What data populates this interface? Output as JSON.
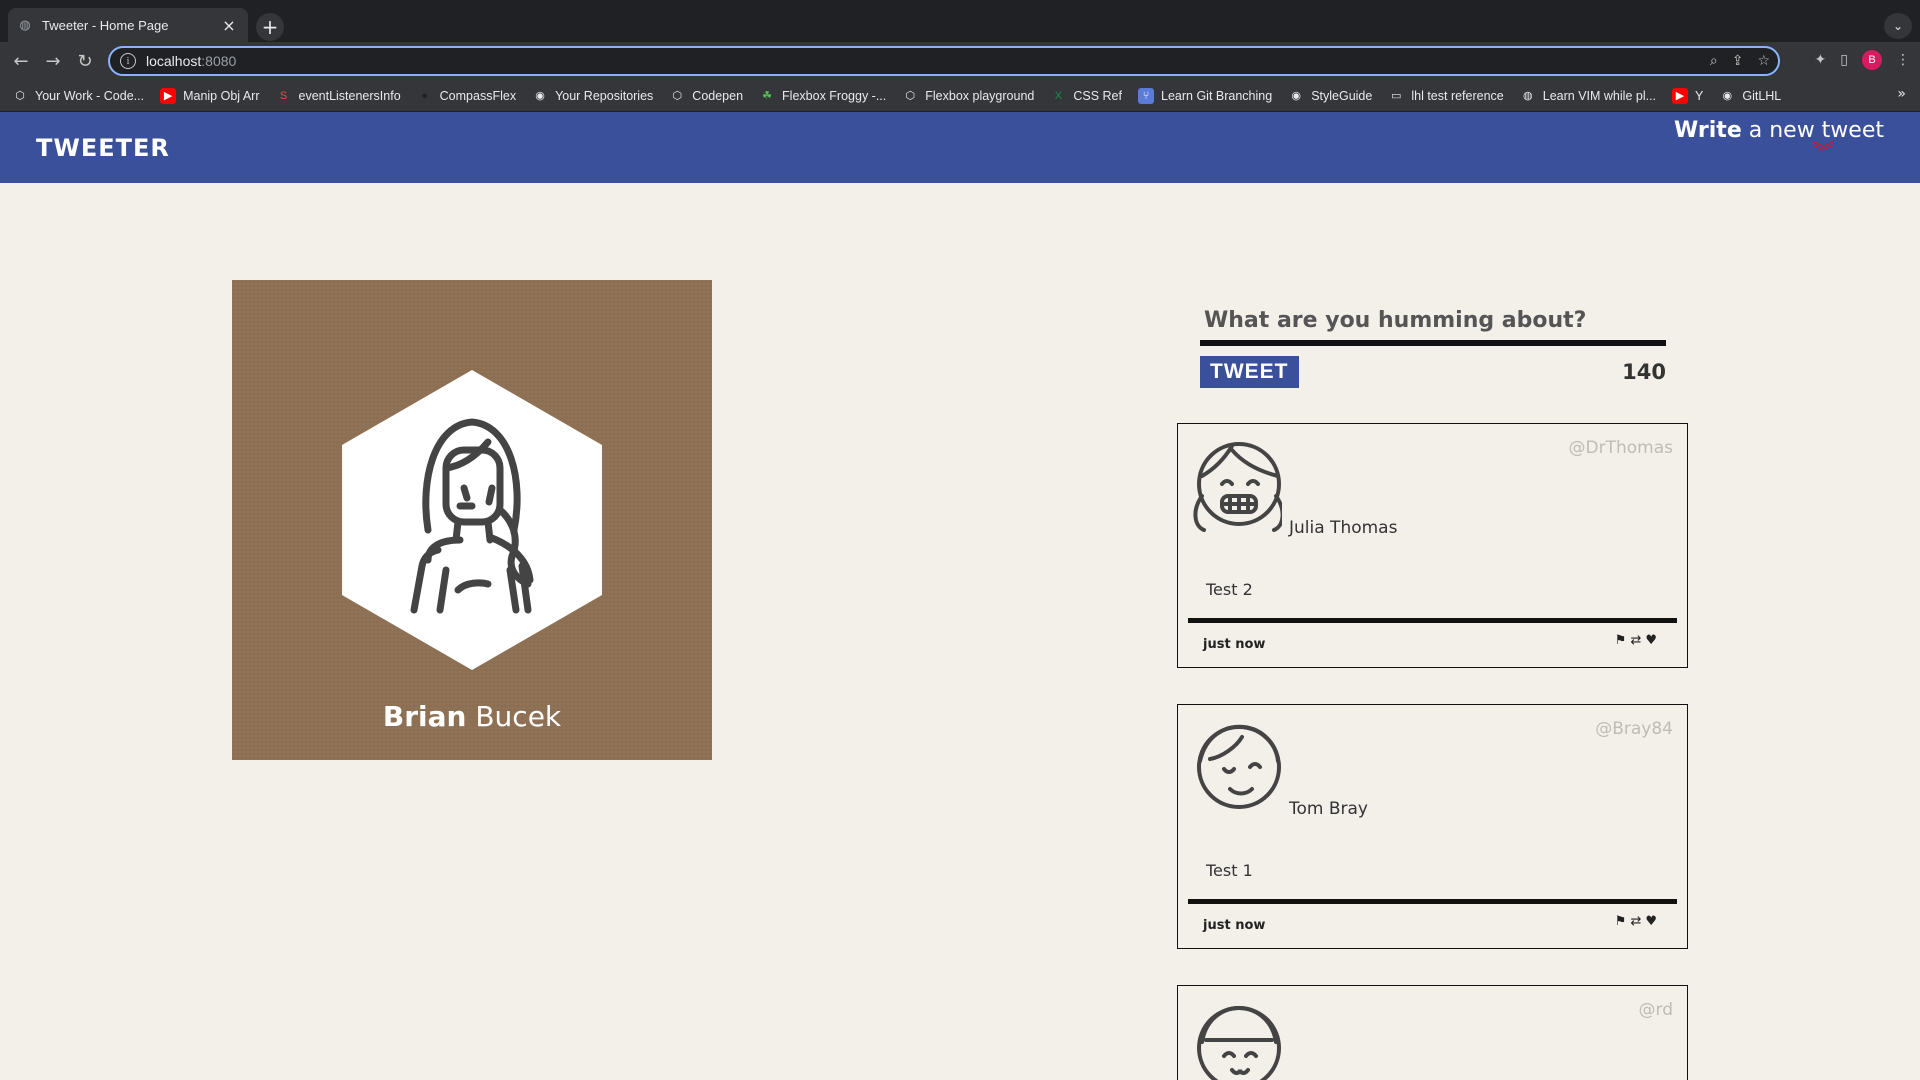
{
  "browser": {
    "tab_title": "Tweeter - Home Page",
    "url_host": "localhost",
    "url_port": ":8080",
    "profile_initial": "B",
    "bookmarks": [
      {
        "label": "Your Work - Code...",
        "icon": "codepen-icon"
      },
      {
        "label": "Manip Obj Arr",
        "icon": "youtube-icon"
      },
      {
        "label": "eventListenersInfo",
        "icon": "s-icon"
      },
      {
        "label": "CompassFlex",
        "icon": "circle-icon"
      },
      {
        "label": "Your Repositories",
        "icon": "github-icon"
      },
      {
        "label": "Codepen",
        "icon": "codepen-icon"
      },
      {
        "label": "Flexbox Froggy -...",
        "icon": "frog-icon"
      },
      {
        "label": "Flexbox playground",
        "icon": "codepen-icon"
      },
      {
        "label": "CSS Ref",
        "icon": "x-icon"
      },
      {
        "label": "Learn Git Branching",
        "icon": "git-icon"
      },
      {
        "label": "StyleGuide",
        "icon": "github-icon"
      },
      {
        "label": "lhl test reference",
        "icon": "folder-icon"
      },
      {
        "label": "Learn VIM while pl...",
        "icon": "globe-icon"
      },
      {
        "label": "Y",
        "icon": "youtube-icon"
      },
      {
        "label": "GitLHL",
        "icon": "github-icon"
      }
    ]
  },
  "nav": {
    "brand": "TWEETER",
    "compose_bold": "Write",
    "compose_rest": " a new tweet"
  },
  "profile": {
    "first_name": "Brian",
    "last_name": " Bucek"
  },
  "composer": {
    "placeholder": "What are you humming about?",
    "button": "TWEET",
    "counter": "140"
  },
  "tweets": [
    {
      "handle": "@DrThomas",
      "name": "Julia Thomas",
      "text": "Test 2",
      "time": "just now"
    },
    {
      "handle": "@Bray84",
      "name": "Tom Bray",
      "text": "Test 1",
      "time": "just now"
    },
    {
      "handle": "@rd"
    }
  ],
  "colors": {
    "nav": "#3b509b",
    "page": "#f3f0ea",
    "profile_bg": "#8f7155",
    "accent_red": "#d6132f"
  }
}
